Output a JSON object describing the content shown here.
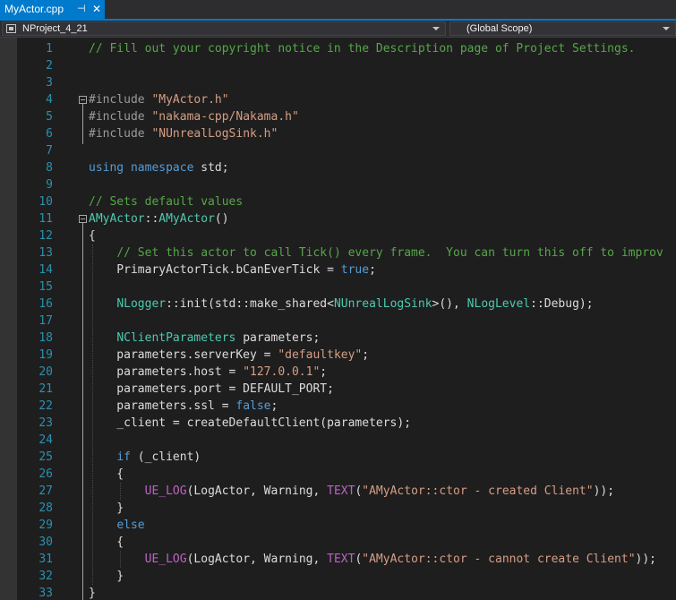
{
  "tab": {
    "title": "MyActor.cpp",
    "pin": "⊣",
    "close": "✕"
  },
  "nav": {
    "project": "NProject_4_21",
    "scope": "(Global Scope)"
  },
  "lines": [
    {
      "n": "1",
      "code": "// Fill out your copyright notice in the Description page of Project Settings."
    },
    {
      "n": "2",
      "code": ""
    },
    {
      "n": "3",
      "code": ""
    },
    {
      "n": "4",
      "code": "#include \"MyActor.h\""
    },
    {
      "n": "5",
      "code": "#include \"nakama-cpp/Nakama.h\""
    },
    {
      "n": "6",
      "code": "#include \"NUnrealLogSink.h\""
    },
    {
      "n": "7",
      "code": ""
    },
    {
      "n": "8",
      "code": "using namespace std;"
    },
    {
      "n": "9",
      "code": ""
    },
    {
      "n": "10",
      "code": "// Sets default values"
    },
    {
      "n": "11",
      "code": "AMyActor::AMyActor()"
    },
    {
      "n": "12",
      "code": "{"
    },
    {
      "n": "13",
      "code": "    // Set this actor to call Tick() every frame.  You can turn this off to improv"
    },
    {
      "n": "14",
      "code": "    PrimaryActorTick.bCanEverTick = true;"
    },
    {
      "n": "15",
      "code": ""
    },
    {
      "n": "16",
      "code": "    NLogger::init(std::make_shared<NUnrealLogSink>(), NLogLevel::Debug);"
    },
    {
      "n": "17",
      "code": ""
    },
    {
      "n": "18",
      "code": "    NClientParameters parameters;"
    },
    {
      "n": "19",
      "code": "    parameters.serverKey = \"defaultkey\";"
    },
    {
      "n": "20",
      "code": "    parameters.host = \"127.0.0.1\";"
    },
    {
      "n": "21",
      "code": "    parameters.port = DEFAULT_PORT;"
    },
    {
      "n": "22",
      "code": "    parameters.ssl = false;"
    },
    {
      "n": "23",
      "code": "    _client = createDefaultClient(parameters);"
    },
    {
      "n": "24",
      "code": ""
    },
    {
      "n": "25",
      "code": "    if (_client)"
    },
    {
      "n": "26",
      "code": "    {"
    },
    {
      "n": "27",
      "code": "        UE_LOG(LogActor, Warning, TEXT(\"AMyActor::ctor - created Client\"));"
    },
    {
      "n": "28",
      "code": "    }"
    },
    {
      "n": "29",
      "code": "    else"
    },
    {
      "n": "30",
      "code": "    {"
    },
    {
      "n": "31",
      "code": "        UE_LOG(LogActor, Warning, TEXT(\"AMyActor::ctor - cannot create Client\"));"
    },
    {
      "n": "32",
      "code": "    }"
    },
    {
      "n": "33",
      "code": "}"
    }
  ]
}
